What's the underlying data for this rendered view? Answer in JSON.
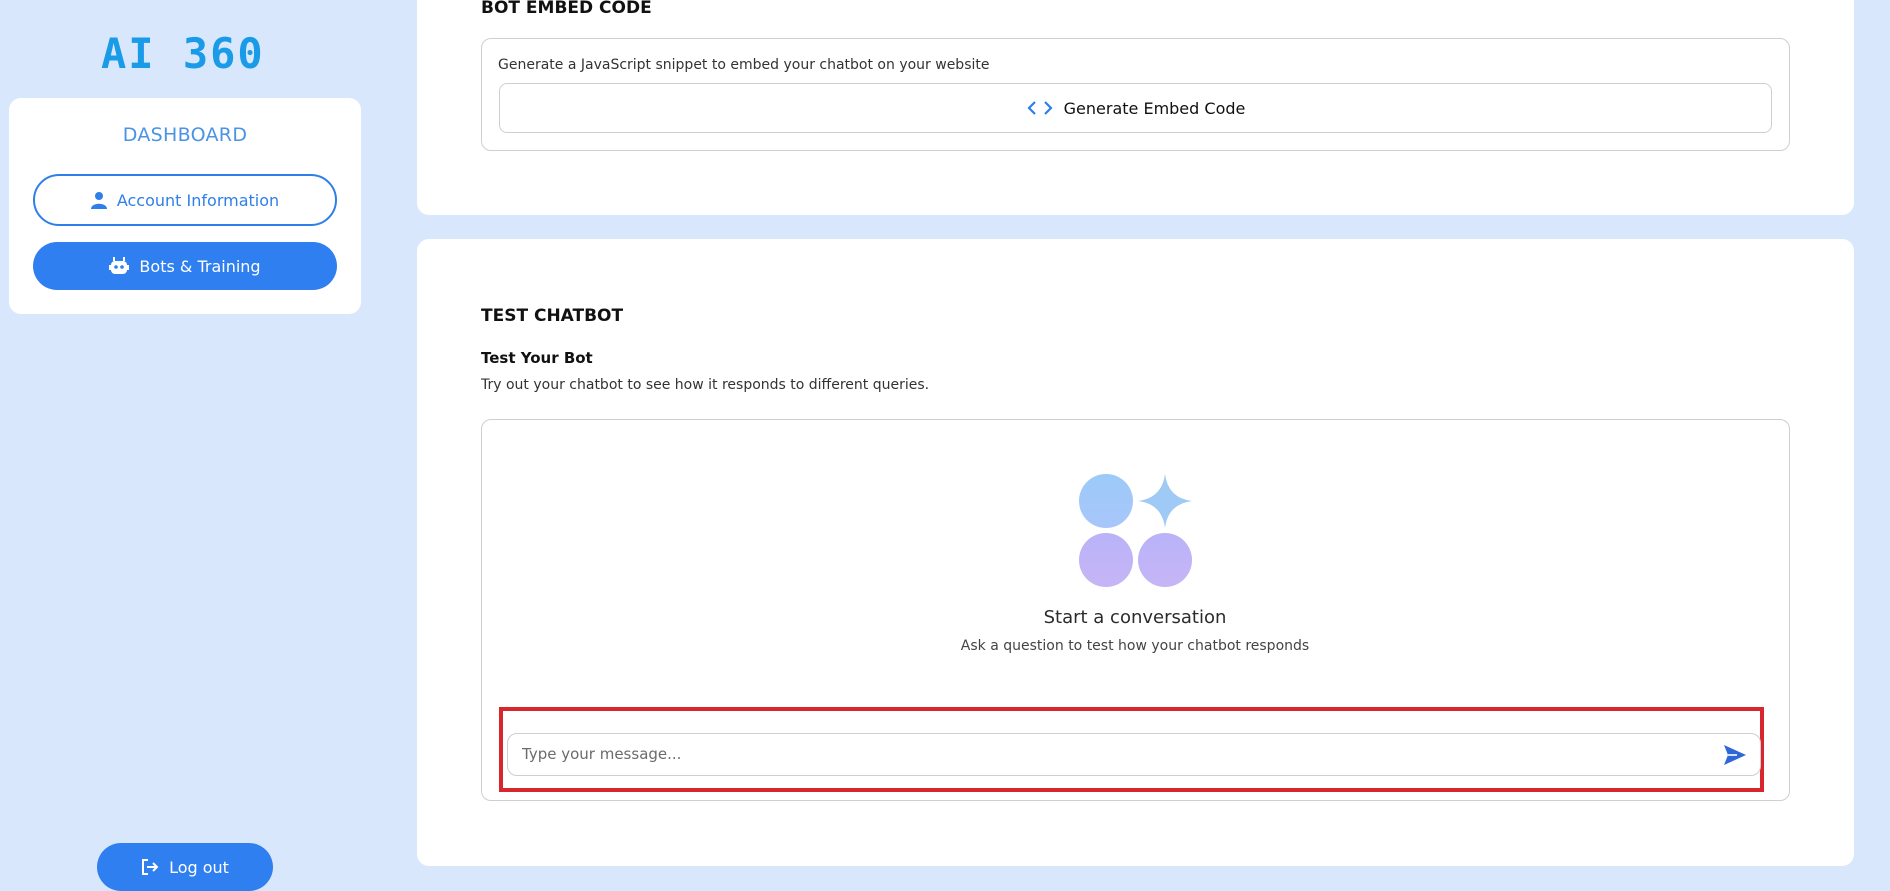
{
  "brand": {
    "logo_text": "AI 360"
  },
  "sidebar": {
    "title": "DASHBOARD",
    "items": [
      {
        "label": "Account Information",
        "icon": "user-icon"
      },
      {
        "label": "Bots & Training",
        "icon": "robot-icon"
      }
    ],
    "logout_label": "Log out"
  },
  "embed": {
    "heading": "BOT EMBED CODE",
    "description": "Generate a JavaScript snippet to embed your chatbot on your website",
    "button_label": "Generate Embed Code",
    "button_icon": "code-icon"
  },
  "test": {
    "heading": "TEST CHATBOT",
    "subtitle": "Test Your Bot",
    "description": "Try out your chatbot to see how it responds to different queries.",
    "empty_title": "Start a conversation",
    "empty_description": "Ask a question to test how your chatbot responds",
    "input_placeholder": "Type your message...",
    "send_icon": "send-icon"
  },
  "colors": {
    "page_bg": "#d8e7fb",
    "accent": "#2f7ff0",
    "logo": "#1a9be8",
    "highlight": "#d8262e"
  }
}
